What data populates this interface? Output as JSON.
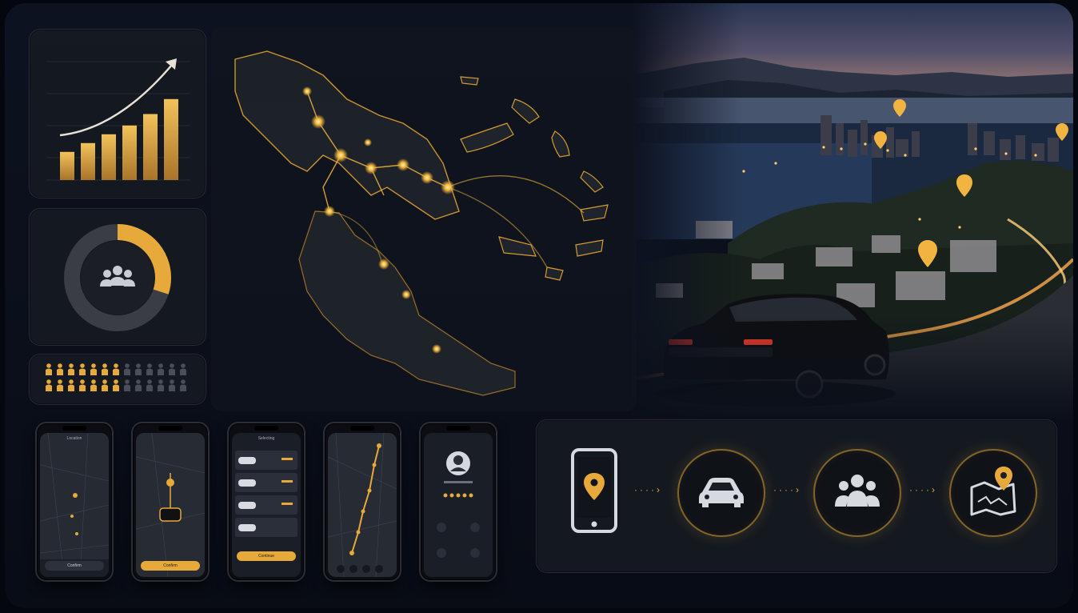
{
  "dashboard": {
    "growth_chart": {
      "bars": [
        0.32,
        0.42,
        0.52,
        0.62,
        0.75,
        0.92
      ],
      "trend_icon": "arrow-up-right-icon"
    },
    "donut": {
      "filled_fraction": 0.3,
      "center_icon": "group-icon"
    },
    "people_grid": {
      "rows": 2,
      "per_row": 13,
      "highlighted_per_row": 7,
      "icon": "person-icon"
    }
  },
  "map": {
    "icon": "network-map",
    "nodes_color": "#f5b73b"
  },
  "city_scene": {
    "pin_icon": "location-pin-icon",
    "vehicle_icon": "car-image"
  },
  "phones": [
    {
      "screen": "map",
      "title": "Location",
      "button": "Confirm"
    },
    {
      "screen": "car",
      "title": "",
      "button": "Confirm"
    },
    {
      "screen": "list",
      "title": "Selecting",
      "button": "Continue"
    },
    {
      "screen": "route",
      "title": "",
      "button": ""
    },
    {
      "screen": "profile",
      "title": "",
      "button": ""
    }
  ],
  "flow": {
    "steps": [
      "phone-location-icon",
      "car-icon",
      "group-icon",
      "map-pin-icon"
    ],
    "accent": "#e6a93a"
  },
  "colors": {
    "accent": "#e6a93a",
    "panel": "#161a22",
    "background": "#0a0f1a"
  }
}
